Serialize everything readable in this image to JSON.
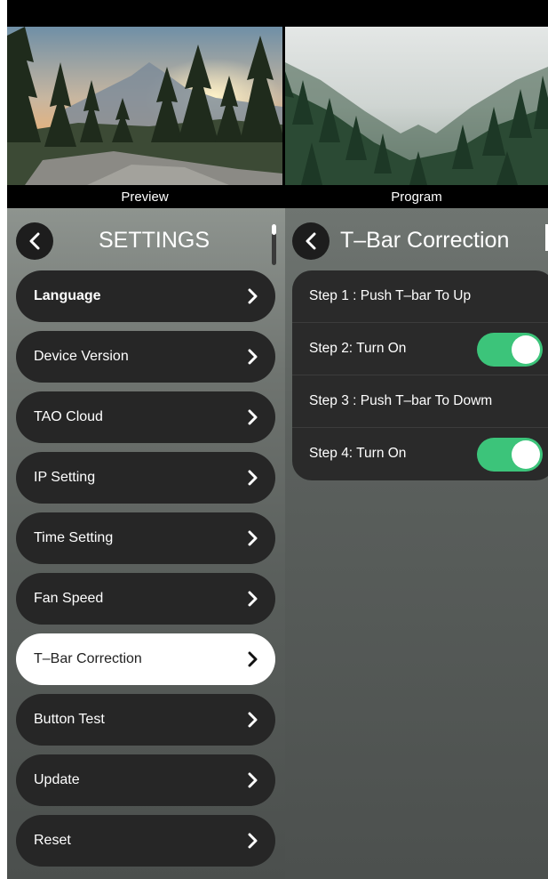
{
  "previews": {
    "left_label": "Preview",
    "right_label": "Program"
  },
  "settings_panel": {
    "title": "SETTINGS",
    "items": [
      {
        "label": "Language"
      },
      {
        "label": "Device Version"
      },
      {
        "label": "TAO Cloud"
      },
      {
        "label": "IP Setting"
      },
      {
        "label": "Time Setting"
      },
      {
        "label": "Fan Speed"
      },
      {
        "label": "T–Bar Correction"
      },
      {
        "label": "Button Test"
      },
      {
        "label": "Update"
      },
      {
        "label": "Reset"
      }
    ],
    "selected": "T–Bar Correction"
  },
  "tbar_panel": {
    "title": "T–Bar Correction",
    "steps": [
      {
        "label": "Step 1 : Push T–bar To Up"
      },
      {
        "label": "Step 2: Turn On",
        "toggle": "on"
      },
      {
        "label": "Step 3 : Push T–bar To Dowm"
      },
      {
        "label": "Step 4: Turn On",
        "toggle": "on"
      }
    ]
  },
  "colors": {
    "toggle_on": "#3cc47a",
    "item_bg": "#262626",
    "item_selected_bg": "#ffffff"
  }
}
